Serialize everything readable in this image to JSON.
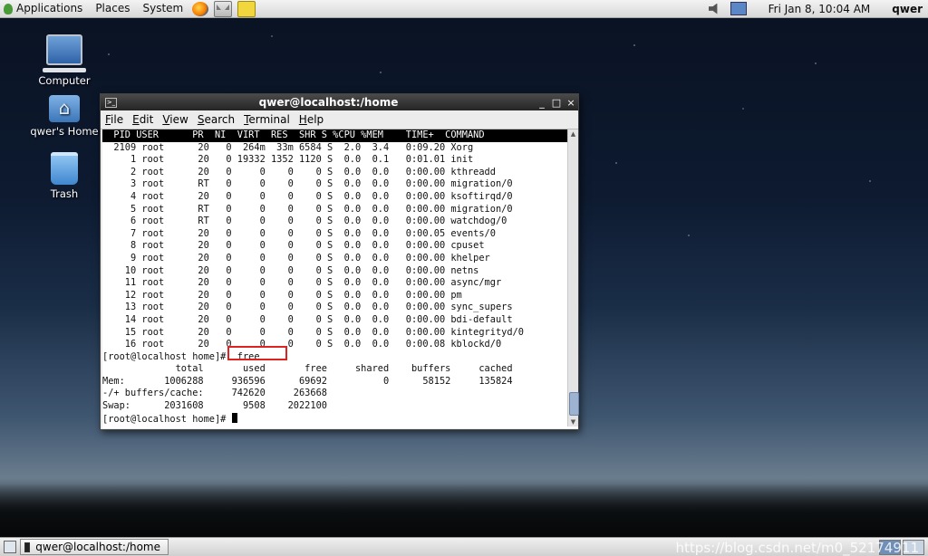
{
  "top_panel": {
    "menus": [
      "Applications",
      "Places",
      "System"
    ],
    "clock": "Fri Jan  8, 10:04 AM",
    "user": "qwer"
  },
  "desktop_icons": [
    {
      "label": "Computer",
      "icon": "computer-icon"
    },
    {
      "label": "qwer's Home",
      "icon": "home-folder-icon"
    },
    {
      "label": "Trash",
      "icon": "trash-icon"
    }
  ],
  "terminal": {
    "title": "qwer@localhost:/home",
    "controls": [
      "_",
      "□",
      "×"
    ],
    "menu": [
      "File",
      "Edit",
      "View",
      "Search",
      "Terminal",
      "Help"
    ],
    "top_header": "  PID USER      PR  NI  VIRT  RES  SHR S %CPU %MEM    TIME+  COMMAND            ",
    "processes": [
      "  2109 root      20   0  264m  33m 6584 S  2.0  3.4   0:09.20 Xorg",
      "     1 root      20   0 19332 1352 1120 S  0.0  0.1   0:01.01 init",
      "     2 root      20   0     0    0    0 S  0.0  0.0   0:00.00 kthreadd",
      "     3 root      RT   0     0    0    0 S  0.0  0.0   0:00.00 migration/0",
      "     4 root      20   0     0    0    0 S  0.0  0.0   0:00.00 ksoftirqd/0",
      "     5 root      RT   0     0    0    0 S  0.0  0.0   0:00.00 migration/0",
      "     6 root      RT   0     0    0    0 S  0.0  0.0   0:00.00 watchdog/0",
      "     7 root      20   0     0    0    0 S  0.0  0.0   0:00.05 events/0",
      "     8 root      20   0     0    0    0 S  0.0  0.0   0:00.00 cpuset",
      "     9 root      20   0     0    0    0 S  0.0  0.0   0:00.00 khelper",
      "    10 root      20   0     0    0    0 S  0.0  0.0   0:00.00 netns",
      "    11 root      20   0     0    0    0 S  0.0  0.0   0:00.00 async/mgr",
      "    12 root      20   0     0    0    0 S  0.0  0.0   0:00.00 pm",
      "    13 root      20   0     0    0    0 S  0.0  0.0   0:00.00 sync_supers",
      "    14 root      20   0     0    0    0 S  0.0  0.0   0:00.00 bdi-default",
      "    15 root      20   0     0    0    0 S  0.0  0.0   0:00.00 kintegrityd/0",
      "    16 root      20   0     0    0    0 S  0.0  0.0   0:00.08 kblockd/0"
    ],
    "prompt_free": "[root@localhost home]#  free",
    "free_header": "             total       used       free     shared    buffers     cached",
    "free_rows": [
      "Mem:       1006288     936596      69692          0      58152     135824",
      "-/+ buffers/cache:     742620     263668",
      "Swap:      2031608       9508    2022100"
    ],
    "prompt_last": "[root@localhost home]# "
  },
  "taskbar": {
    "window_button": "qwer@localhost:/home"
  },
  "watermark": "https://blog.csdn.net/m0_52174911"
}
